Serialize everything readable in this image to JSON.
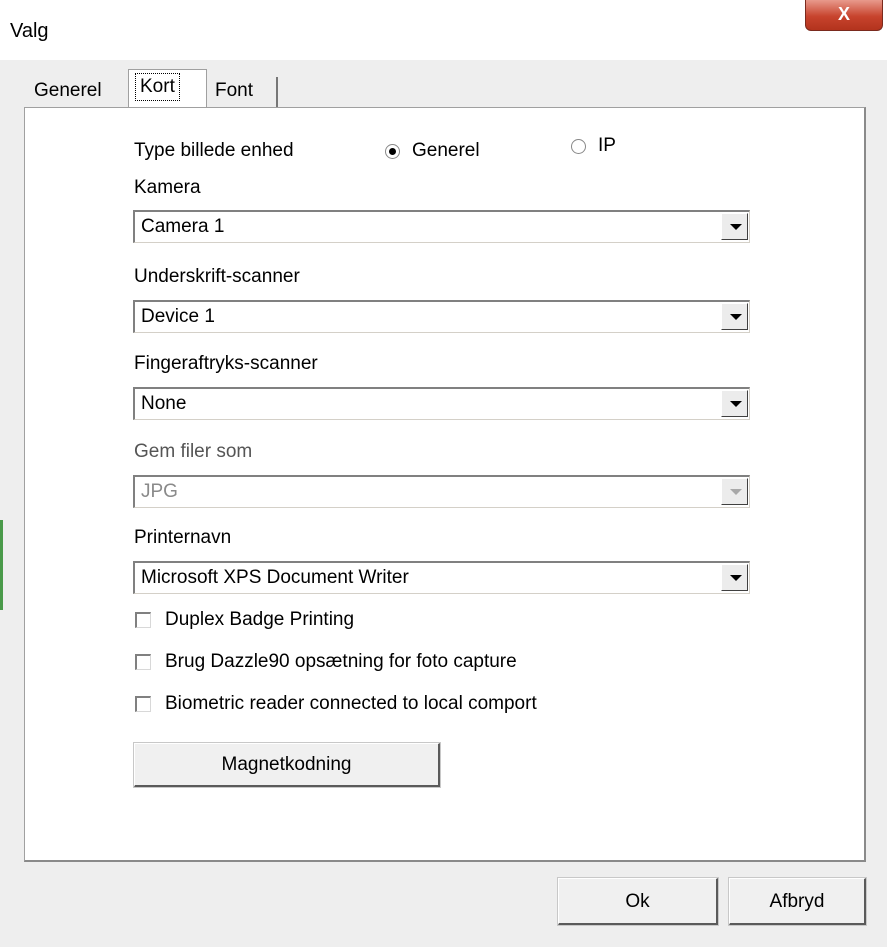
{
  "window": {
    "title": "Valg",
    "close_label": "X"
  },
  "tabs": [
    {
      "label": "Generel"
    },
    {
      "label": "Kort"
    },
    {
      "label": "Font"
    }
  ],
  "image_device": {
    "label": "Type billede enhed",
    "options": [
      {
        "label": "Generel",
        "selected": true
      },
      {
        "label": "IP",
        "selected": false
      }
    ]
  },
  "camera": {
    "label": "Kamera",
    "value": "Camera 1"
  },
  "signature_scanner": {
    "label": "Underskrift-scanner",
    "value": "Device 1"
  },
  "fingerprint_scanner": {
    "label": "Fingeraftryks-scanner",
    "value": "None"
  },
  "save_format": {
    "label": "Gem filer som",
    "value": "JPG",
    "disabled": true
  },
  "printer": {
    "label": "Printernavn",
    "value": "Microsoft XPS Document Writer"
  },
  "checkboxes": [
    {
      "label": "Duplex Badge Printing",
      "checked": false
    },
    {
      "label": "Brug Dazzle90 opsætning for foto capture",
      "checked": false
    },
    {
      "label": "Biometric reader connected to local comport",
      "checked": false
    }
  ],
  "magnet_button": "Magnetkodning",
  "footer": {
    "ok": "Ok",
    "cancel": "Afbryd"
  },
  "colors": {
    "close_button": "#c7432d",
    "panel_bg": "#ffffff",
    "window_bg": "#eeeeee"
  }
}
